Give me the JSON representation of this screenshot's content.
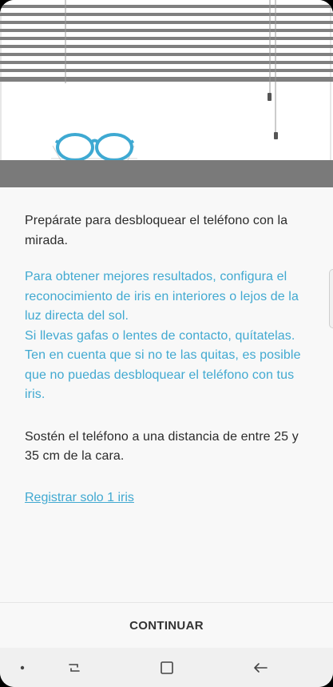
{
  "illustration": {
    "icon": "iris-setup-illustration",
    "accent": "#3ea9d2",
    "blind_color": "#7f7f7f",
    "sill_color": "#7a7a7a"
  },
  "content": {
    "intro": "Prepárate para desbloquear el teléfono con la mirada.",
    "tip_lighting": "Para obtener mejores resultados, configura el reconocimiento de iris en interiores o lejos de la luz directa del sol.",
    "tip_glasses": "Si llevas gafas o lentes de contacto, quítatelas. Ten en cuenta que si no te las quitas, es posible que no puedas desbloquear el teléfono con tus iris.",
    "distance": "Sostén el teléfono a una distancia de entre 25 y 35 cm de la cara.",
    "register_one_link": "Registrar solo 1 iris"
  },
  "footer": {
    "continue_label": "CONTINUAR"
  },
  "navbar": {
    "indicator": "dot-icon",
    "recent": "recent-apps-icon",
    "home": "home-icon",
    "back": "back-icon"
  },
  "colors": {
    "link": "#41a9d1",
    "text": "#2b2b2b",
    "background": "#f8f8f8"
  }
}
